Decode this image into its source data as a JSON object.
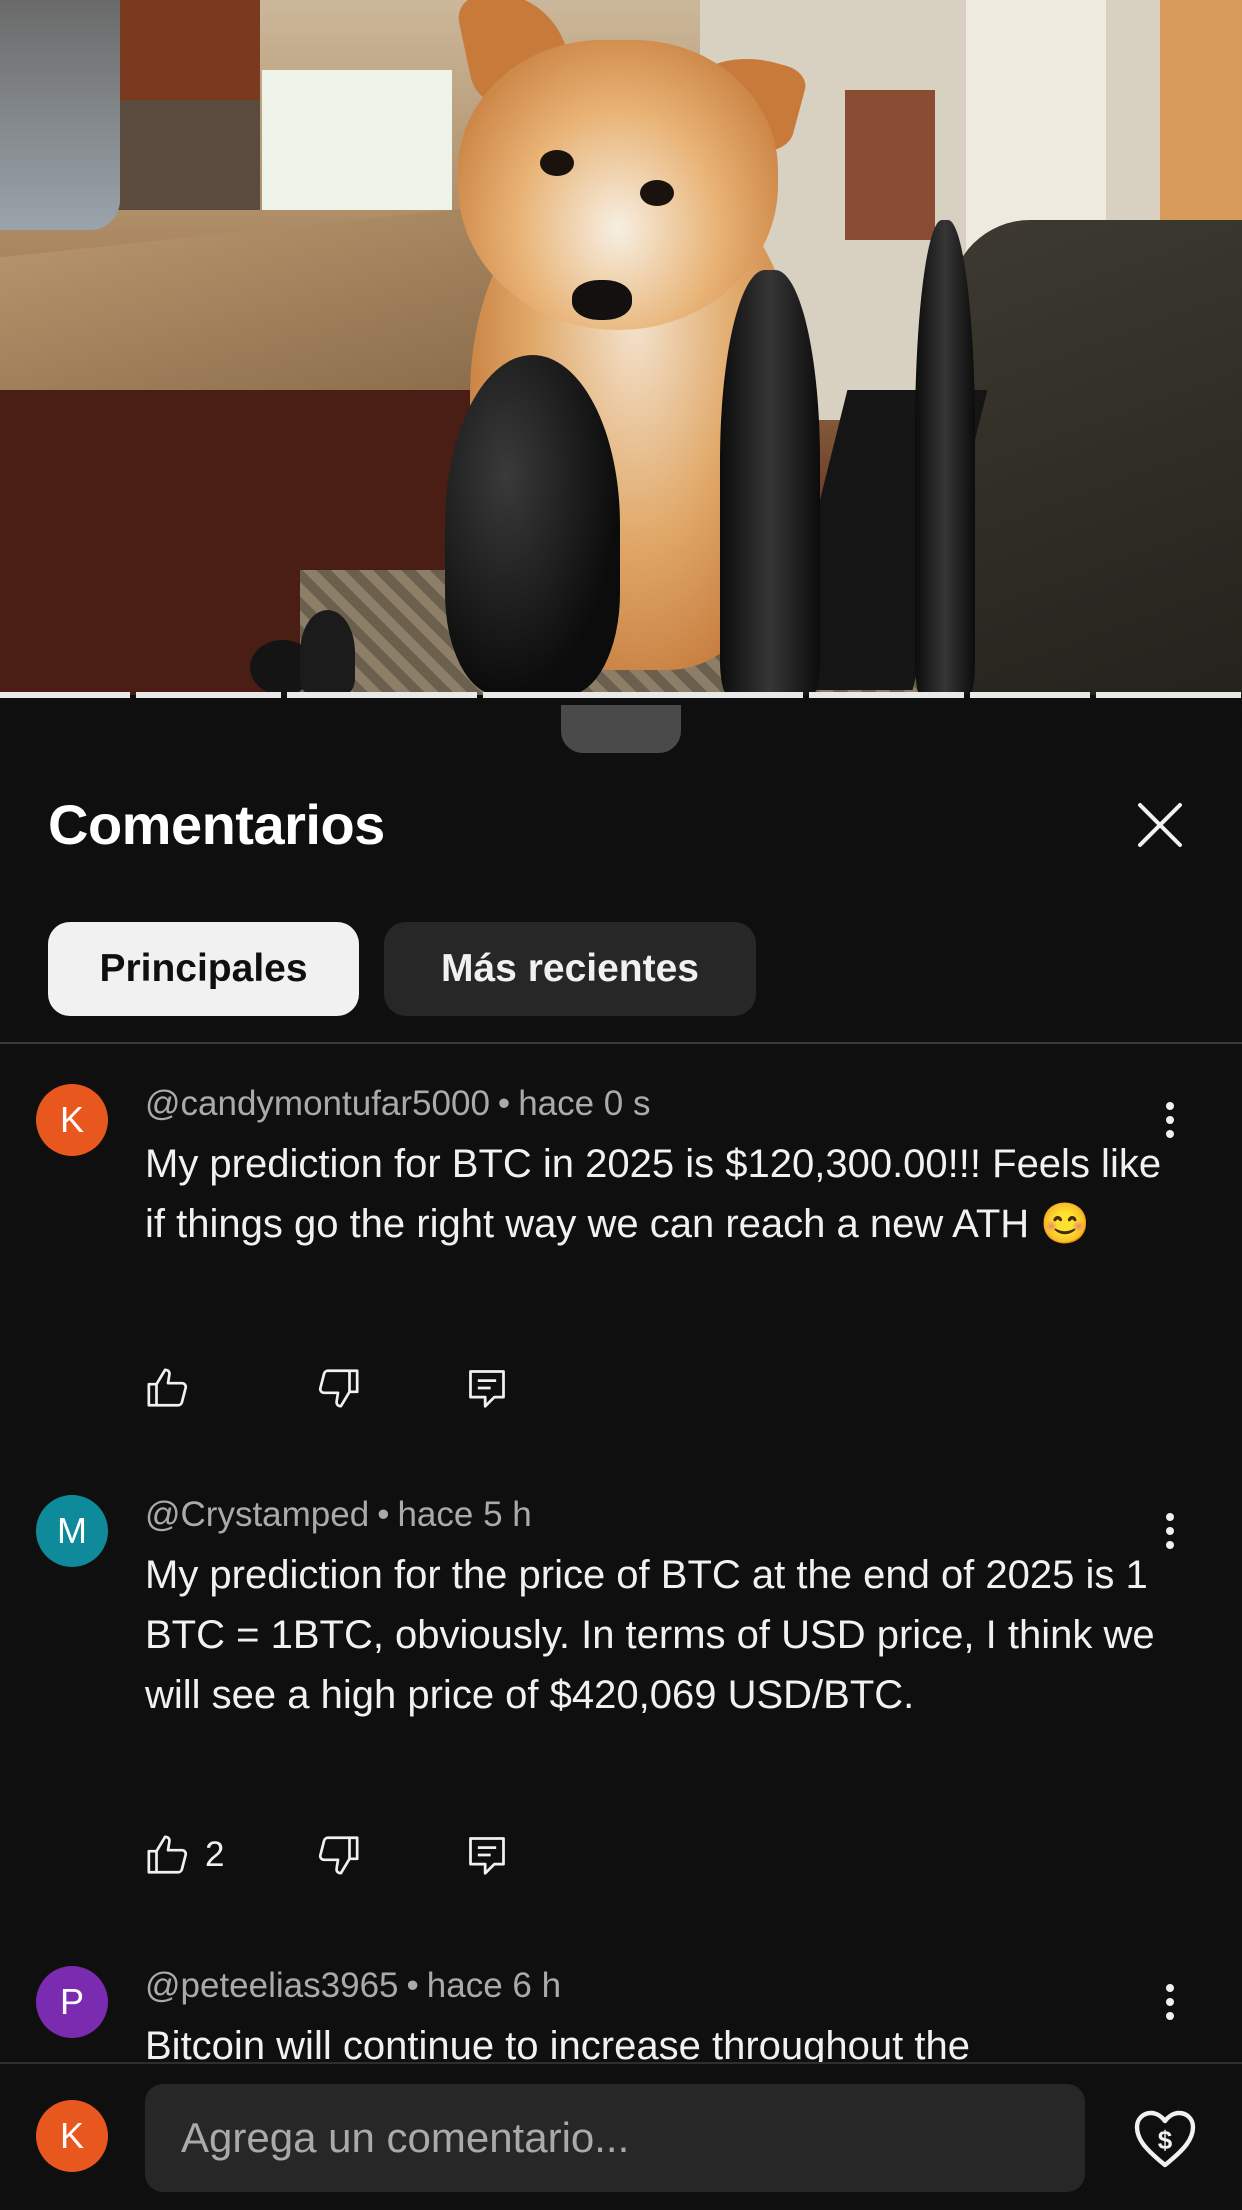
{
  "sheet": {
    "title": "Comentarios",
    "filters": [
      {
        "label": "Principales",
        "selected": true
      },
      {
        "label": "Más recientes",
        "selected": false
      }
    ]
  },
  "comments": [
    {
      "avatar_letter": "K",
      "avatar_color": "#e8571e",
      "author": "@candymontufar5000",
      "time": "hace 0 s",
      "text": "My prediction for BTC in 2025 is $120,300.00!!! Feels like if things go the right way we can reach a new ATH 😊",
      "likes": ""
    },
    {
      "avatar_letter": "M",
      "avatar_color": "#0e8a9a",
      "author": "@Crystamped",
      "time": "hace 5 h",
      "text": "My prediction for the price of BTC at the end of 2025 is 1 BTC = 1BTC, obviously.  In terms of USD price, I think we will see a high price of $420,069 USD/BTC.",
      "likes": "2"
    },
    {
      "avatar_letter": "P",
      "avatar_color": "#7b2bb0",
      "author": "@peteelias3965",
      "time": "hace 6 h",
      "text": "Bitcoin will continue to increase throughout the",
      "likes": ""
    }
  ],
  "composer": {
    "avatar_letter": "K",
    "avatar_color": "#e8571e",
    "placeholder": "Agrega un comentario..."
  },
  "meta_separator": "•",
  "icons": {
    "close": "close-icon",
    "more": "more-vertical-icon",
    "like": "thumb-up-icon",
    "dislike": "thumb-down-icon",
    "reply": "reply-comment-icon",
    "thanks": "super-thanks-heart-dollar-icon"
  }
}
